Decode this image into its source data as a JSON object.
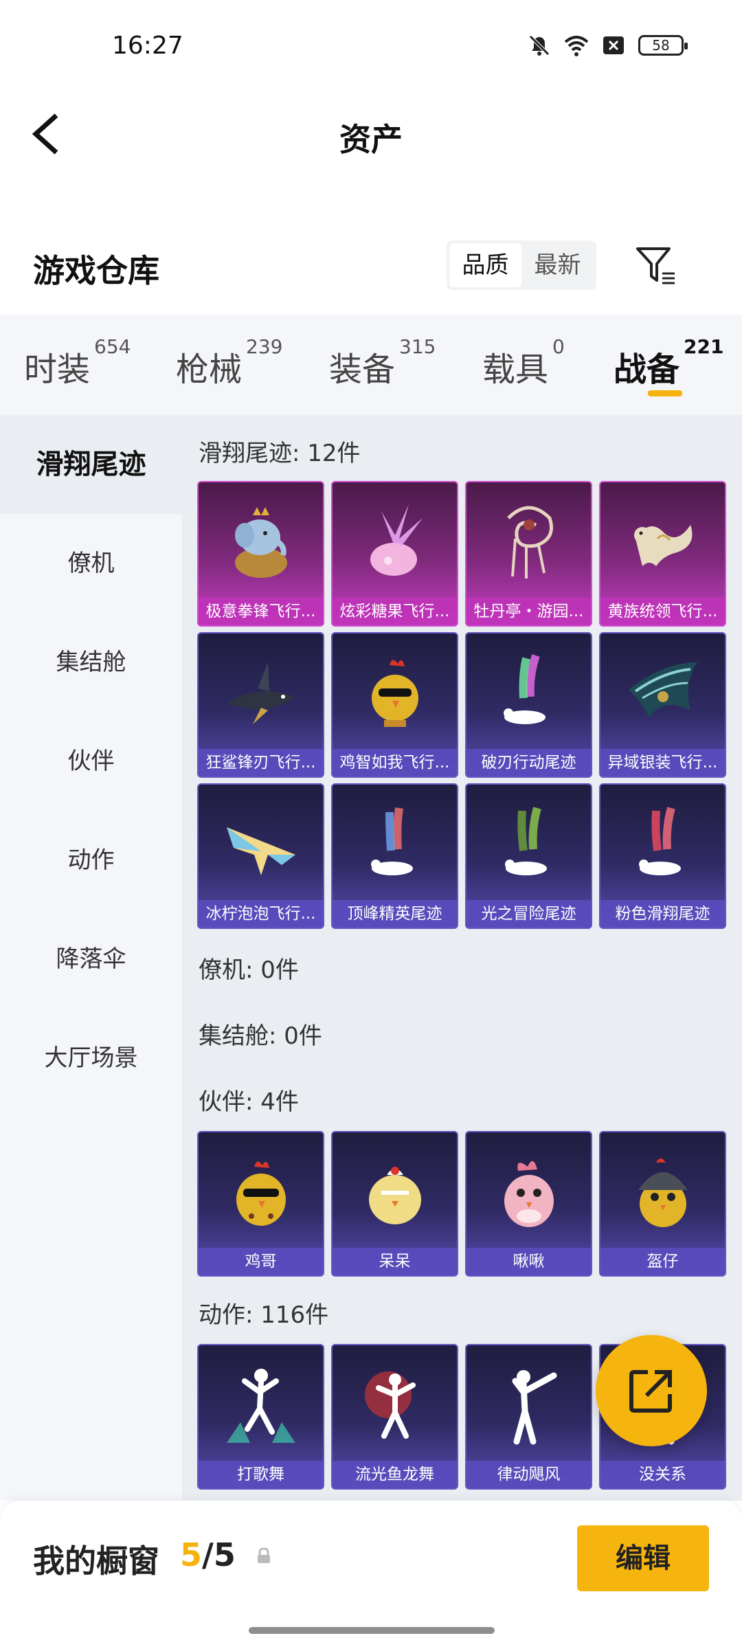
{
  "status": {
    "time": "16:27",
    "battery": "58"
  },
  "nav": {
    "title": "资产"
  },
  "warehouse": {
    "label": "游戏仓库",
    "sort_options": [
      "品质",
      "最新"
    ],
    "active_sort": "品质"
  },
  "tabs": [
    {
      "label": "时装",
      "count": "654"
    },
    {
      "label": "枪械",
      "count": "239"
    },
    {
      "label": "装备",
      "count": "315"
    },
    {
      "label": "载具",
      "count": "0"
    },
    {
      "label": "战备",
      "count": "221"
    }
  ],
  "sidebar": [
    {
      "label": "滑翔尾迹"
    },
    {
      "label": "僚机"
    },
    {
      "label": "集结舱"
    },
    {
      "label": "伙伴"
    },
    {
      "label": "动作"
    },
    {
      "label": "降落伞"
    },
    {
      "label": "大厅场景"
    }
  ],
  "sections": [
    {
      "title": "滑翔尾迹: 12件",
      "items": [
        {
          "name": "极意拳锋飞行...",
          "quality": "purple",
          "icon": "elephant-glider-icon"
        },
        {
          "name": "炫彩糖果飞行...",
          "quality": "purple",
          "icon": "candy-glider-icon"
        },
        {
          "name": "牡丹亭・游园...",
          "quality": "purple",
          "icon": "peony-glider-icon"
        },
        {
          "name": "黄族统领飞行...",
          "quality": "purple",
          "icon": "dragon-glider-icon"
        },
        {
          "name": "狂鲨锋刃飞行...",
          "quality": "blue",
          "icon": "shark-glider-icon"
        },
        {
          "name": "鸡智如我飞行...",
          "quality": "blue",
          "icon": "chicken-glider-icon"
        },
        {
          "name": "破刃行动尾迹",
          "quality": "blue",
          "icon": "rainbow-trail-icon"
        },
        {
          "name": "异域银装飞行...",
          "quality": "blue",
          "icon": "wing-glider-icon"
        },
        {
          "name": "冰柠泡泡飞行...",
          "quality": "blue",
          "icon": "plane-glider-icon"
        },
        {
          "name": "顶峰精英尾迹",
          "quality": "blue",
          "icon": "elite-trail-icon"
        },
        {
          "name": "光之冒险尾迹",
          "quality": "blue",
          "icon": "green-trail-icon"
        },
        {
          "name": "粉色滑翔尾迹",
          "quality": "blue",
          "icon": "pink-trail-icon"
        }
      ]
    },
    {
      "title": "僚机: 0件",
      "items": []
    },
    {
      "title": "集结舱: 0件",
      "items": []
    },
    {
      "title": "伙伴: 4件",
      "items": [
        {
          "name": "鸡哥",
          "quality": "blue",
          "icon": "chicken-sunglasses-icon"
        },
        {
          "name": "呆呆",
          "quality": "blue",
          "icon": "chick-icon"
        },
        {
          "name": "啾啾",
          "quality": "blue",
          "icon": "pink-bird-icon"
        },
        {
          "name": "盔仔",
          "quality": "blue",
          "icon": "helmet-chick-icon"
        }
      ]
    },
    {
      "title": "动作: 116件",
      "items": [
        {
          "name": "打歌舞",
          "quality": "blue",
          "icon": "dance-icon"
        },
        {
          "name": "流光鱼龙舞",
          "quality": "blue",
          "icon": "firework-dance-icon"
        },
        {
          "name": "律动飓风",
          "quality": "blue",
          "icon": "pose-icon"
        },
        {
          "name": "没关系",
          "quality": "blue",
          "icon": "gesture-icon"
        }
      ]
    }
  ],
  "showcase": {
    "label": "我的橱窗",
    "current": "5",
    "total": "5",
    "edit_label": "编辑"
  },
  "colors": {
    "accent": "#f6b40e",
    "purple_quality": "#c83ec3",
    "blue_quality": "#5a4bb0"
  }
}
